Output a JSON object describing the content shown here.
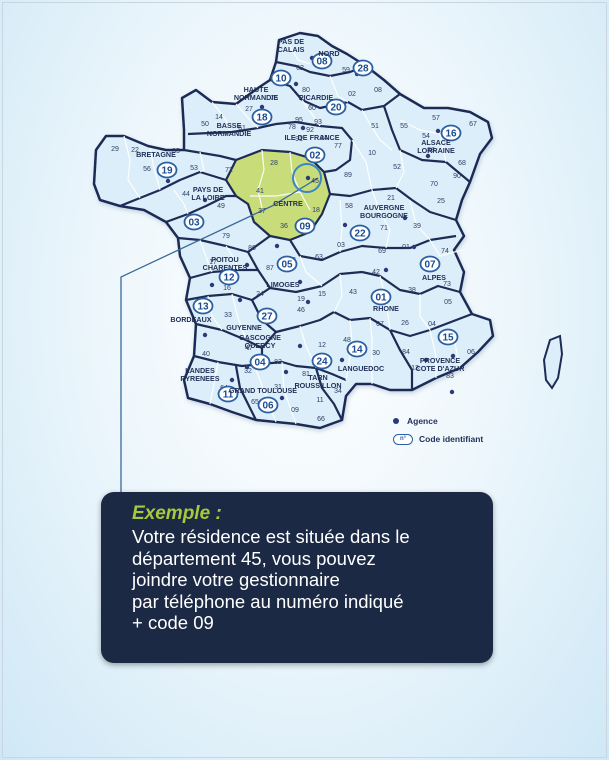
{
  "colors": {
    "map_fill": "#dceef9",
    "map_border": "#1d2c55",
    "highlight_fill": "#c8dc7a",
    "box_bg": "#1b2945",
    "title_green": "#a7c93e",
    "code_blue": "#2a5fa3"
  },
  "regions": [
    {
      "id": "pas-de-calais",
      "lines": [
        "PAS DE",
        "CALAIS"
      ]
    },
    {
      "id": "nord",
      "lines": [
        "NORD"
      ]
    },
    {
      "id": "haute-normandie",
      "lines": [
        "HAUTE",
        "NORMANDIE"
      ]
    },
    {
      "id": "picardie",
      "lines": [
        "PICARDIE"
      ]
    },
    {
      "id": "basse-normandie",
      "lines": [
        "BASSE",
        "NORMANDIE"
      ]
    },
    {
      "id": "ile-de-france",
      "lines": [
        "ILE DE FRANCE"
      ]
    },
    {
      "id": "alsace-lorraine",
      "lines": [
        "ALSACE",
        "LORRAINE"
      ]
    },
    {
      "id": "bretagne",
      "lines": [
        "BRETAGNE"
      ]
    },
    {
      "id": "pays-de-la-loire",
      "lines": [
        "PAYS DE",
        "LA LOIRE"
      ]
    },
    {
      "id": "centre",
      "lines": [
        "CENTRE"
      ]
    },
    {
      "id": "auvergne-bourgogne",
      "lines": [
        "AUVERGNE",
        "BOURGOGNE"
      ]
    },
    {
      "id": "poitou-charentes",
      "lines": [
        "POITOU",
        "CHARENTES"
      ]
    },
    {
      "id": "alpes",
      "lines": [
        "ALPES"
      ]
    },
    {
      "id": "limoges",
      "lines": [
        "LIMOGES"
      ]
    },
    {
      "id": "rhone",
      "lines": [
        "RHONE"
      ]
    },
    {
      "id": "bordeaux",
      "lines": [
        "BORDEAUX"
      ]
    },
    {
      "id": "guyenne",
      "lines": [
        "GUYENNE"
      ]
    },
    {
      "id": "gascogne-quercy",
      "lines": [
        "GASCOGNE",
        "QUERCY"
      ]
    },
    {
      "id": "languedoc",
      "lines": [
        "LANGUEDOC"
      ]
    },
    {
      "id": "provence-cote-dazur",
      "lines": [
        "PROVENCE",
        "COTE D'AZUR"
      ]
    },
    {
      "id": "landes-pyrenees",
      "lines": [
        "LANDES",
        "PYRENEES"
      ]
    },
    {
      "id": "tarn-roussillon",
      "lines": [
        "TARN",
        "ROUSSILLON"
      ]
    },
    {
      "id": "grand-toulouse",
      "lines": [
        "GRAND TOULOUSE"
      ]
    }
  ],
  "codes": [
    "08",
    "28",
    "10",
    "20",
    "18",
    "16",
    "02",
    "19",
    "03",
    "09",
    "22",
    "05",
    "07",
    "12",
    "01",
    "13",
    "27",
    "15",
    "04",
    "24",
    "14",
    "11",
    "06"
  ],
  "departments": [
    "62",
    "59",
    "80",
    "02",
    "08",
    "76",
    "60",
    "95",
    "14",
    "27",
    "78",
    "93",
    "92",
    "94",
    "91",
    "77",
    "51",
    "55",
    "57",
    "67",
    "68",
    "88",
    "54",
    "50",
    "61",
    "29",
    "22",
    "56",
    "35",
    "53",
    "72",
    "28",
    "45",
    "41",
    "37",
    "18",
    "36",
    "49",
    "44",
    "85",
    "58",
    "89",
    "10",
    "52",
    "70",
    "90",
    "21",
    "71",
    "39",
    "25",
    "79",
    "86",
    "17",
    "16",
    "87",
    "23",
    "03",
    "63",
    "69",
    "01",
    "42",
    "74",
    "73",
    "38",
    "19",
    "15",
    "43",
    "07",
    "26",
    "33",
    "24",
    "46",
    "47",
    "12",
    "48",
    "30",
    "84",
    "05",
    "04",
    "06",
    "83",
    "13",
    "40",
    "32",
    "82",
    "81",
    "34",
    "64",
    "65",
    "31",
    "09",
    "11",
    "66"
  ],
  "legend": {
    "agence": "Agence",
    "code": "Code identifiant",
    "code_pill": "n°"
  },
  "example": {
    "title": "Exemple :",
    "lines": [
      "Votre résidence est située dans le",
      "département 45, vous pouvez",
      "joindre votre gestionnaire",
      "par téléphone au numéro indiqué",
      "+ code 09"
    ]
  }
}
